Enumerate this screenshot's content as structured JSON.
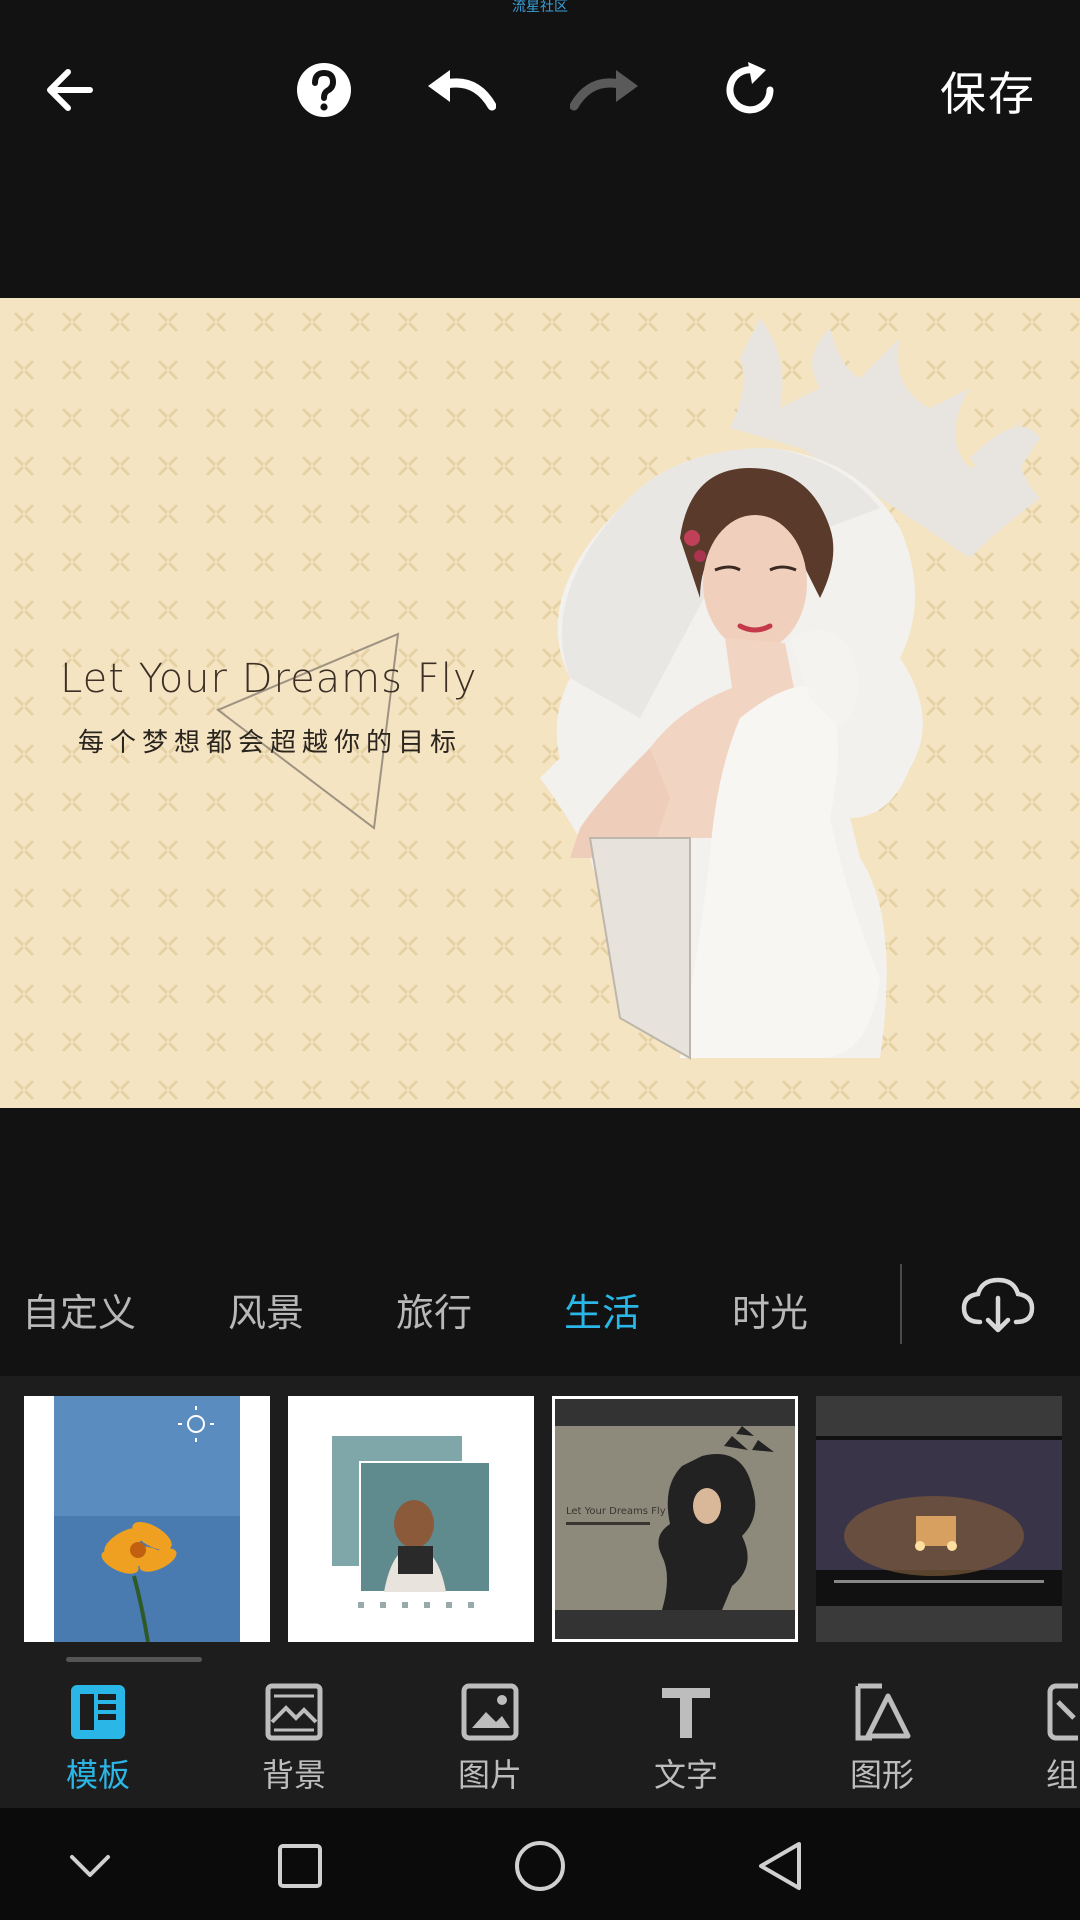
{
  "watermark": "流星社区",
  "toolbar": {
    "back_icon": "arrow-left-icon",
    "help_icon": "help-circle-icon",
    "undo_icon": "undo-icon",
    "redo_icon": "redo-icon",
    "reset_icon": "refresh-icon",
    "save_label": "保存"
  },
  "canvas": {
    "title": "Let Your Dreams Fly",
    "subtitle": "每个梦想都会超越你的目标",
    "background_color": "#f5e4c2"
  },
  "categories": {
    "items": [
      "自定义",
      "风景",
      "旅行",
      "生活",
      "时光"
    ],
    "active": "生活",
    "download_icon": "cloud-download-icon"
  },
  "thumbnails": [
    {
      "label": "flower-template"
    },
    {
      "label": "portrait-frame-template"
    },
    {
      "label": "silhouette-template",
      "caption": "Let Your Dreams Fly"
    },
    {
      "label": "night-street-template"
    }
  ],
  "tools": [
    {
      "label": "模板",
      "icon": "template-icon",
      "active": true
    },
    {
      "label": "背景",
      "icon": "background-icon"
    },
    {
      "label": "图片",
      "icon": "image-icon"
    },
    {
      "label": "文字",
      "icon": "text-icon"
    },
    {
      "label": "图形",
      "icon": "shape-icon"
    },
    {
      "label": "组",
      "icon": "group-icon"
    }
  ],
  "colors": {
    "accent": "#2ab6e6",
    "toolbar_bg": "#121212",
    "panel_bg": "#1d1d1d"
  }
}
